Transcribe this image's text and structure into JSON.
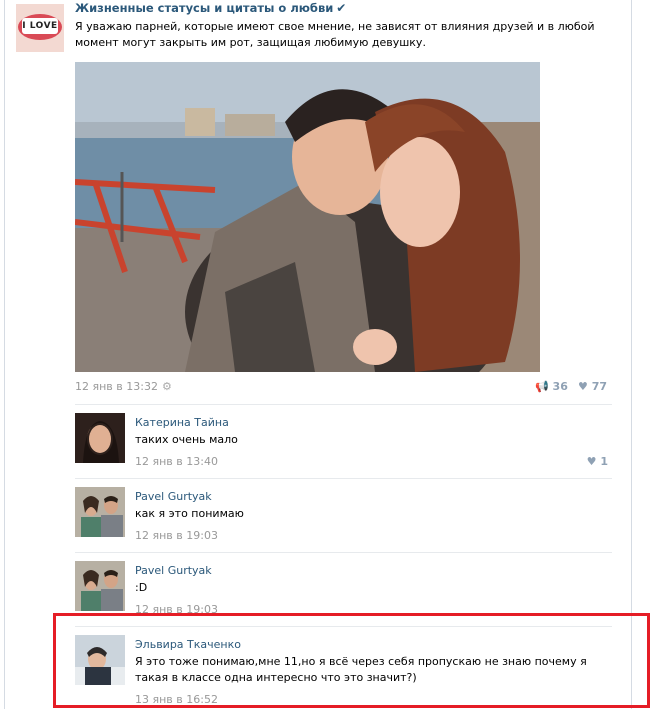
{
  "post": {
    "group_name": "Жизненные статусы и цитаты о любви",
    "avatar_text": "I LOVE",
    "text": "Я уважаю парней, которые имеют свое мнение, не зависят от влияния друзей и в любой момент могут закрыть им рот, защищая любимую девушку.",
    "date": "12 янв в 13:32",
    "shares": "36",
    "likes": "77"
  },
  "comments": [
    {
      "author": "Катерина Тайна",
      "text": "таких очень мало",
      "date": "12 янв в 13:40",
      "likes": "1"
    },
    {
      "author": "Pavel Gurtyak",
      "text": "как я это понимаю",
      "date": "12 янв в 19:03"
    },
    {
      "author": "Pavel Gurtyak",
      "text": ":D",
      "date": "12 янв в 19:03"
    },
    {
      "author": "Эльвира Ткаченко",
      "text": "Я это тоже понимаю,мне 11,но я всё через себя пропускаю не знаю почему я такая в классе одна интересно что это значит?)",
      "date": "13 янв в 16:52"
    }
  ],
  "icons": {
    "verified": "check-icon",
    "gear": "gear-icon",
    "share": "megaphone-icon",
    "like": "heart-icon"
  },
  "colors": {
    "link": "#2b587a",
    "meta": "#999999",
    "counter": "#8fa1b4",
    "highlight": "#e51d26"
  }
}
